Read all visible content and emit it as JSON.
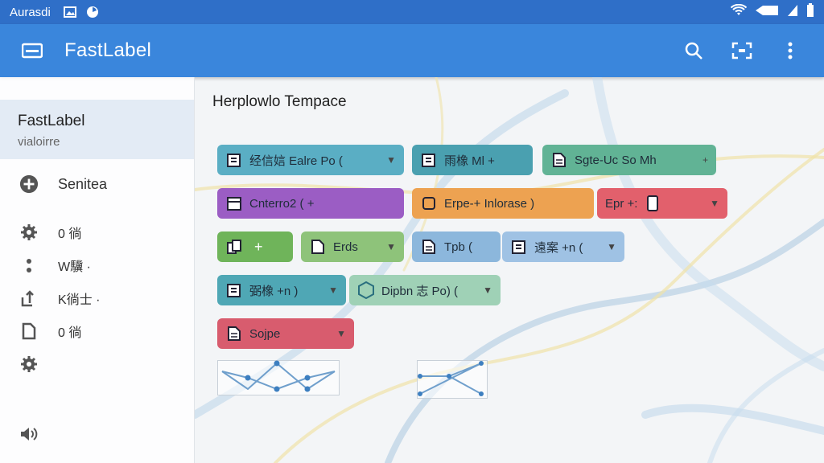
{
  "status_bar": {
    "carrier": "Aurasdi"
  },
  "app_bar": {
    "title": "FastLabel"
  },
  "sidebar": {
    "header_title": "FastLabel",
    "header_subtitle": "vialoirre",
    "main_item": "Senitea",
    "items": [
      {
        "label": "0 徜",
        "icon": "gear-icon"
      },
      {
        "label": "W驥 ·",
        "icon": "dot-icon"
      },
      {
        "label": "K徜士 ·",
        "icon": "upload-icon"
      },
      {
        "label": "0 徜",
        "icon": "document-icon"
      },
      {
        "label": "",
        "icon": "settings-icon"
      }
    ]
  },
  "canvas": {
    "title": "Herplowlo Tempace",
    "chips": [
      {
        "label": "经信娮  Ealre Po (",
        "color": "#5aaec4"
      },
      {
        "label": "雨橡 Ml +",
        "color": "#4aa0b0"
      },
      {
        "label": "Sgte-Uc So  Mh",
        "color": "#61b395"
      },
      {
        "label": "Cnterro2  (  +",
        "color": "#9b5dc4"
      },
      {
        "label": "Erpe-+ Inlorase )",
        "color": "#eda251"
      },
      {
        "label": "Epr +:",
        "color": "#e2606c"
      },
      {
        "label": "+",
        "color": "#6fb45a"
      },
      {
        "label": "Erds",
        "color": "#8ec37a"
      },
      {
        "label": "Tpb (",
        "color": "#8cb7dc"
      },
      {
        "label": "遠案  +n (",
        "color": "#9fc2e4"
      },
      {
        "label": "弼橡 +n )",
        "color": "#4fa7b5"
      },
      {
        "label": "Dipbn 志 Po) (",
        "color": "#9fd1b6"
      },
      {
        "label": "Sojpe",
        "color": "#d85c6e"
      }
    ]
  }
}
